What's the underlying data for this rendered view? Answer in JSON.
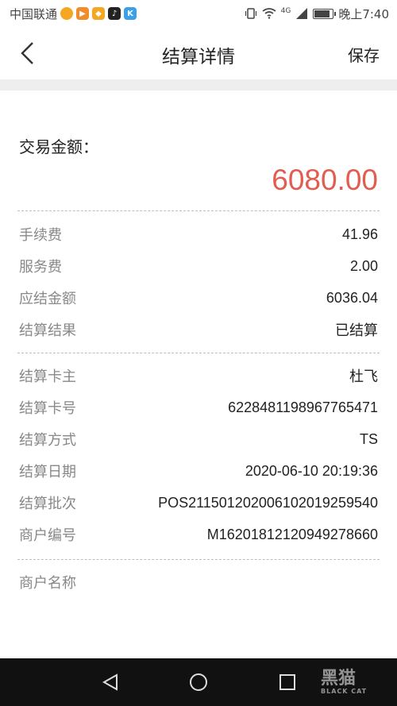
{
  "status_bar": {
    "carrier": "中国联通",
    "time": "晚上7:40",
    "network": "4G",
    "app_icons": [
      "weather-icon",
      "video-app-icon",
      "shop-app-icon",
      "tiktok-icon",
      "k-app-icon"
    ]
  },
  "header": {
    "title": "结算详情",
    "save_label": "保存"
  },
  "amount": {
    "label": "交易金额：",
    "value": "6080.00",
    "color": "#e25c50"
  },
  "fees": [
    {
      "key": "手续费",
      "value": "41.96"
    },
    {
      "key": "服务费",
      "value": "2.00"
    },
    {
      "key": "应结金额",
      "value": "6036.04"
    },
    {
      "key": "结算结果",
      "value": "已结算"
    }
  ],
  "settlement": [
    {
      "key": "结算卡主",
      "value": "杜飞"
    },
    {
      "key": "结算卡号",
      "value": "6228481198967765471"
    },
    {
      "key": "结算方式",
      "value": "TS"
    },
    {
      "key": "结算日期",
      "value": "2020-06-10 20:19:36"
    },
    {
      "key": "结算批次",
      "value": "POS21150120200610201925954 0"
    },
    {
      "key": "商户编号",
      "value": "M16201812120949278660"
    }
  ],
  "merchant": {
    "name_label": "商户名称",
    "name_value": ""
  },
  "watermark": {
    "main": "黑猫",
    "sub": "BLACK CAT"
  }
}
